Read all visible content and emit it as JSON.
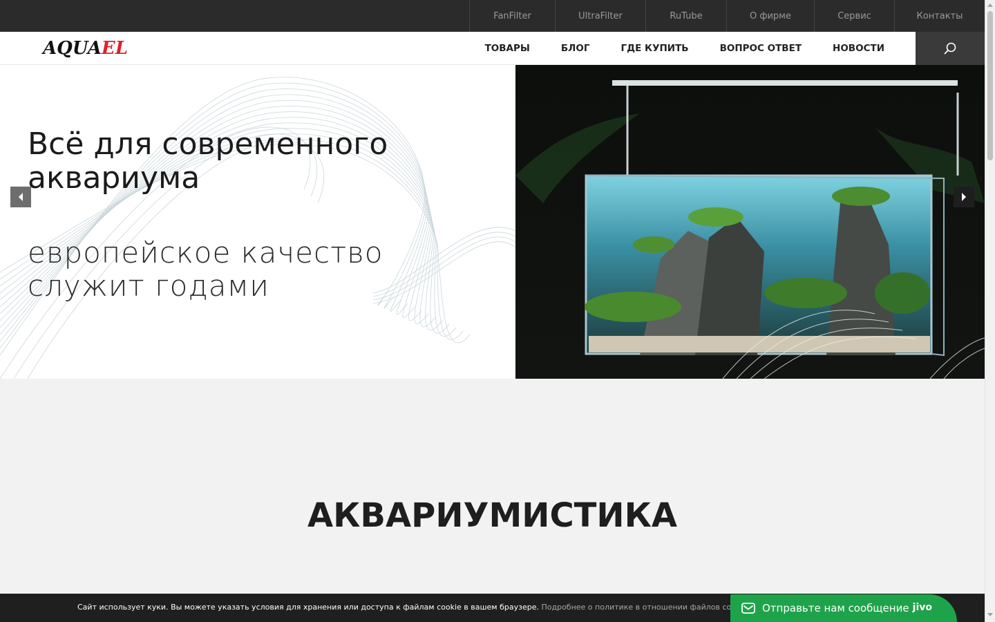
{
  "topbar": {
    "links": [
      {
        "label": "FanFilter"
      },
      {
        "label": "UltraFilter"
      },
      {
        "label": "RuTube"
      },
      {
        "label": "О фирме"
      },
      {
        "label": "Сервис"
      },
      {
        "label": "Контакты"
      }
    ]
  },
  "header": {
    "logo_part1": "AQUA",
    "logo_part2": "EL",
    "nav": [
      {
        "label": "ТОВАРЫ"
      },
      {
        "label": "БЛОГ"
      },
      {
        "label": "ГДЕ КУПИТЬ"
      },
      {
        "label": "ВОПРОС ОТВЕТ"
      },
      {
        "label": "НОВОСТИ"
      }
    ],
    "search_icon": "search-icon"
  },
  "hero": {
    "title": "Всё для современного аквариума",
    "subtitle": "европейское качество служит годами",
    "prev_icon": "chevron-left-icon",
    "next_icon": "chevron-right-icon"
  },
  "section": {
    "title": "АКВАРИУМИСТИКА"
  },
  "cookie": {
    "text": "Сайт использует куки. Вы можете указать условия для хранения или доступа к файлам cookie в вашем браузере.",
    "link": "Подробнее о политике в отношении файлов cookie"
  },
  "chat": {
    "label": "Отправьте нам сообщение",
    "brand": "jivo",
    "icon": "mail-icon",
    "color": "#1fa34a"
  },
  "colors": {
    "topbar": "#2b2b2b",
    "search_button": "#3a3a3a",
    "logo_accent": "#e1202b"
  }
}
